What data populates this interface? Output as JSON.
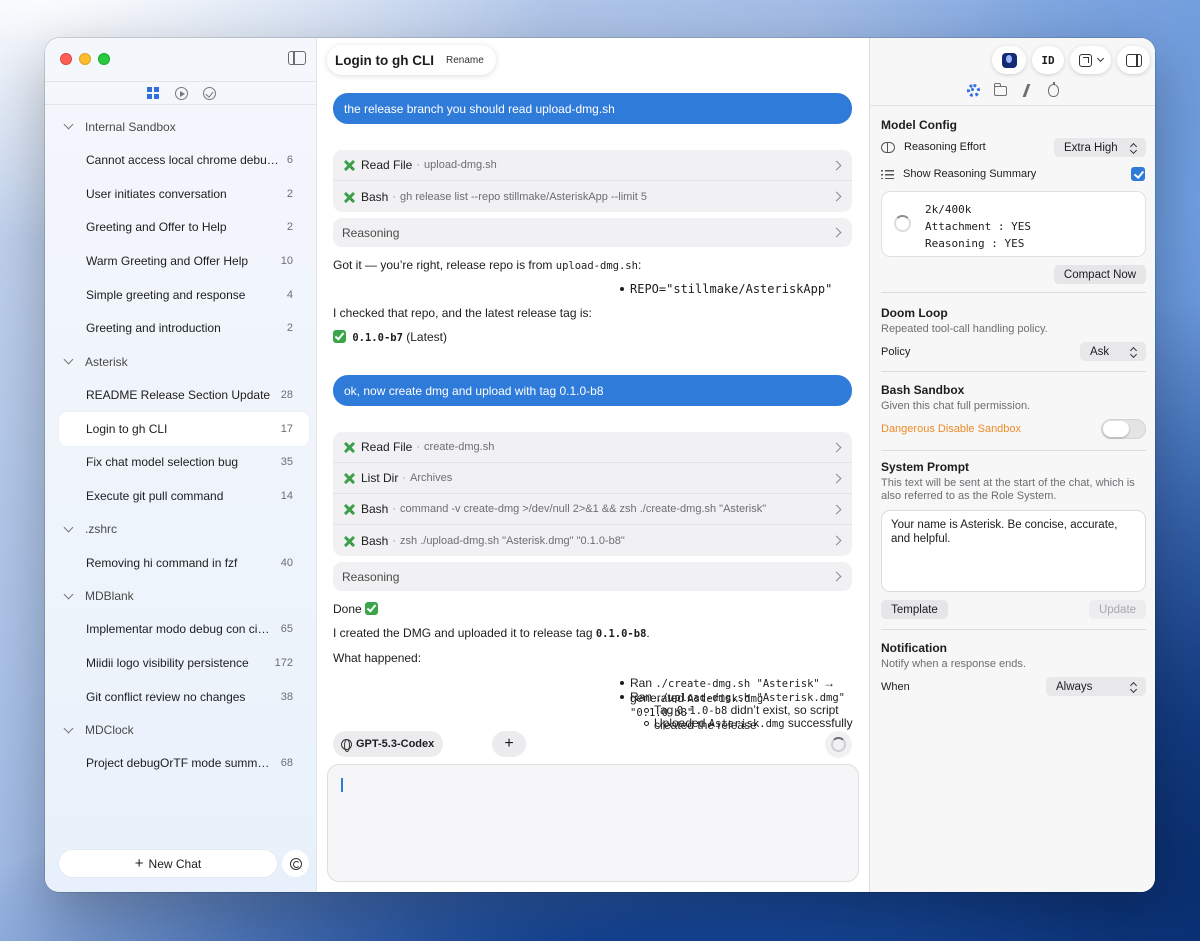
{
  "sidebar": {
    "groups": [
      {
        "name": "Internal Sandbox",
        "items": [
          {
            "title": "Cannot access local chrome debuggi…",
            "count": "6"
          },
          {
            "title": "User initiates conversation",
            "count": "2"
          },
          {
            "title": "Greeting and Offer to Help",
            "count": "2"
          },
          {
            "title": "Warm Greeting and Offer Help",
            "count": "10"
          },
          {
            "title": "Simple greeting and response",
            "count": "4"
          },
          {
            "title": "Greeting and introduction",
            "count": "2"
          }
        ]
      },
      {
        "name": "Asterisk",
        "items": [
          {
            "title": "README Release Section Update",
            "count": "28"
          },
          {
            "title": "Login to gh CLI",
            "count": "17",
            "active": true
          },
          {
            "title": "Fix chat model selection bug",
            "count": "35"
          },
          {
            "title": "Execute git pull command",
            "count": "14"
          }
        ]
      },
      {
        "name": ".zshrc",
        "items": [
          {
            "title": "Removing hi command in fzf",
            "count": "40"
          }
        ]
      },
      {
        "name": "MDBlank",
        "items": [
          {
            "title": "Implementar modo debug con cinco…",
            "count": "65"
          },
          {
            "title": "Miidii logo visibility persistence",
            "count": "172"
          },
          {
            "title": "Git conflict review no changes",
            "count": "38"
          }
        ]
      },
      {
        "name": "MDClock",
        "items": [
          {
            "title": "Project debugOrTF mode summary",
            "count": "68"
          }
        ]
      }
    ],
    "new_chat_label": "New Chat"
  },
  "chat": {
    "title": "Login to gh CLI",
    "rename_label": "Rename",
    "user_msg_1": "the release branch you should read upload-dmg.sh",
    "tools_1": [
      {
        "name": "Read File",
        "arg": "upload-dmg.sh"
      },
      {
        "name": "Bash",
        "arg": "gh release list --repo stillmake/AsteriskApp --limit 5"
      }
    ],
    "reasoning_label": "Reasoning",
    "reply_1": {
      "line1_pre": "Got it — you’re right, release repo is from ",
      "line1_code": "upload-dmg.sh",
      "line1_post": ":",
      "bullet": "REPO=\"stillmake/AsteriskApp\"",
      "line2": "I checked that repo, and the latest release tag is:",
      "tag": "0.1.0-b7",
      "tag_suffix": "(Latest)"
    },
    "user_msg_2": "ok, now create dmg and upload with tag 0.1.0-b8",
    "tools_2": [
      {
        "name": "Read File",
        "arg": "create-dmg.sh"
      },
      {
        "name": "List Dir",
        "arg": "Archives"
      },
      {
        "name": "Bash",
        "arg": "command -v create-dmg >/dev/null 2>&1 && zsh ./create-dmg.sh \"Asterisk\""
      },
      {
        "name": "Bash",
        "arg": "zsh ./upload-dmg.sh \"Asterisk.dmg\" \"0.1.0-b8\""
      }
    ],
    "reply_2": {
      "done": "Done",
      "line_pre": "I created the DMG and uploaded it to release tag ",
      "line_code": "0.1.0-b8",
      "line_post": ".",
      "what": "What happened:",
      "b1_pre": "Ran ",
      "b1_code": "./create-dmg.sh \"Asterisk\"",
      "b1_mid": " → generated ",
      "b1_code2": "Asterisk.dmg",
      "b2_pre": "Ran ",
      "b2_code": "./upload-dmg.sh \"Asterisk.dmg\" \"0.1.0-b8\"",
      "s1_pre": "Tag ",
      "s1_code": "0.1.0-b8",
      "s1_post": " didn’t exist, so script created the release",
      "s2_pre": "Uploaded ",
      "s2_code": "Asterisk.dmg",
      "s2_post": " successfully"
    },
    "model_label": "GPT-5.3-Codex"
  },
  "panel": {
    "id_label": "ID",
    "model_config": {
      "title": "Model Config",
      "effort_label": "Reasoning Effort",
      "effort_value": "Extra High",
      "summary_label": "Show Reasoning Summary",
      "ctx_usage": "2k/400k",
      "attachment": "Attachment : YES",
      "reasoning": "Reasoning : YES",
      "compact_label": "Compact Now"
    },
    "doom_loop": {
      "title": "Doom Loop",
      "subtitle": "Repeated tool-call handling policy.",
      "policy_label": "Policy",
      "policy_value": "Ask"
    },
    "bash_sandbox": {
      "title": "Bash Sandbox",
      "subtitle": "Given this chat full permission.",
      "danger_label": "Dangerous Disable Sandbox"
    },
    "system_prompt": {
      "title": "System Prompt",
      "subtitle": "This text will be sent at the start of the chat, which is also referred to as the Role System.",
      "text": "Your name is Asterisk. Be concise, accurate, and helpful.",
      "template_label": "Template",
      "update_label": "Update"
    },
    "notification": {
      "title": "Notification",
      "subtitle": "Notify when a response ends.",
      "when_label": "When",
      "when_value": "Always"
    }
  }
}
